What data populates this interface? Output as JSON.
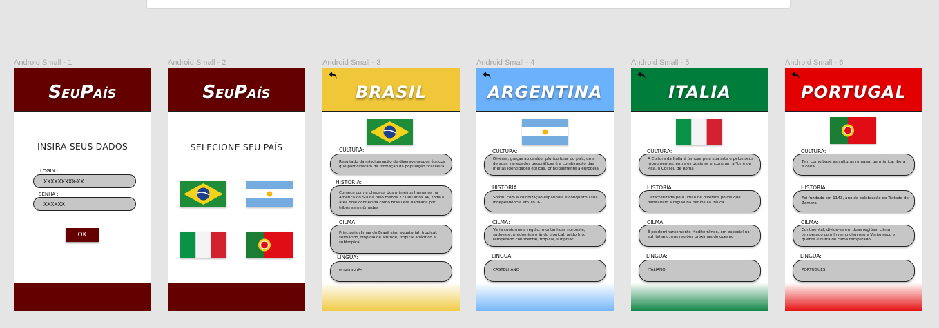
{
  "frames": [
    {
      "label": "Android Small - 1"
    },
    {
      "label": "Android Small - 2"
    },
    {
      "label": "Android Small - 3"
    },
    {
      "label": "Android Small - 4"
    },
    {
      "label": "Android Small - 5"
    },
    {
      "label": "Android Small - 6"
    }
  ],
  "app": {
    "logo": "SeuPaís",
    "brand_color": "#650000"
  },
  "login": {
    "heading": "INSIRA SEUS DADOS",
    "login_label": "LOGIN :",
    "login_value": "XXXXXXXXX-XX",
    "senha_label": "SENHA :",
    "senha_value": "XXXXXX",
    "ok_label": "OK"
  },
  "select": {
    "heading": "SELECIONE SEU PAÍS",
    "flags": [
      "brazil-flag",
      "argentina-flag",
      "italy-flag",
      "portugal-flag"
    ]
  },
  "labels": {
    "cultura": "CULTURA:",
    "historia": "HISTORIA:",
    "clima_brasil": "CILMA:",
    "clima": "CILMA:",
    "lingua": "LINGUA:"
  },
  "countries": [
    {
      "title": "BRASIL",
      "color": "#efc739",
      "cultura": "Resultado da miscigenação de diversos grupos étnicos que participaram da formação da população brasileira",
      "historia": "Começa com a chegada dos primeiros humanos na América do Sul há pelo menos 22 000 anos AP, toda a área hoje conhecida como Brasil era habitada por tribos seminômades",
      "clima": "Principais climas do Brasil são: equatorial, tropical, semiárido, tropical de altitude, tropical atlântico e subtropical.",
      "lingua": "PORTUGUÊS"
    },
    {
      "title": "ARGENTINA",
      "color": "#6cb1fb",
      "cultura": "Diversa, graças ao caráter pluricultural do país, uma de suas variedades geográficas é a combinação das muitas identidades étnicas, principalmente a europeia",
      "historia": "Sofreu com a colonização espanhola e conquistou sua independência em 1816",
      "clima": "Varia conforme a região: montanhosa noroeste, sudoeste, predomina o árido tropical, árido frio, temperado continental, tropical, subpolar",
      "lingua": "CASTELHANO"
    },
    {
      "title": "ITALIA",
      "color": "#007d3a",
      "cultura": "A Cultura da Itália é famosa pela sua arte e pelos seus monumentos, entre os quais se encontram a Torre de Pisa, o Coliseu de Roma",
      "historia": "Caracterizada pela união de diversos povos que habitavam a região na península itálica",
      "clima": "É predominantemente Mediterrâneo, em especial no sul italiano, nas regiões próximas do oceano",
      "lingua": "ITALIANO"
    },
    {
      "title": "PORTUGAL",
      "color": "#e30000",
      "cultura": "Tem como base as culturas romana, germânica, ibera e celta",
      "historia": "Foi fundado em 1143, ano da celebração do Tratado de Zamora",
      "clima": "Continental, divide-se em duas regiões: clima temperado com Inverno chuvoso e Verão seco e quente e outra de clima temperado",
      "lingua": "PORTUGUES"
    }
  ]
}
